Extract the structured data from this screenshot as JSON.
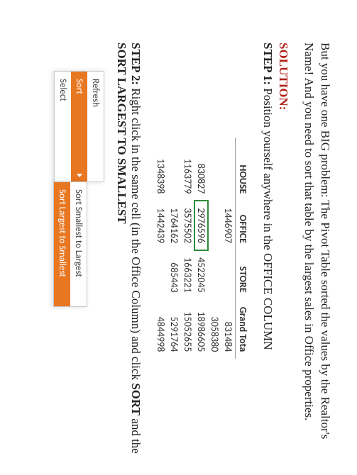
{
  "intro": "But you have one BIG problem: The Pivot Table sorted the values by the Realtor's Name! And you need to sort that table by the largest sales in Office properties.",
  "solution_label": "SOLUTION:",
  "step1_label": "STEP 1:",
  "step1_text": " Position yourself anywhere in the OFFICE COLUMN",
  "step2_label": "STEP 2:",
  "step2_text_a": " Right click in the same cell (in the Office Column) and click ",
  "step2_sort": "SORT",
  "step2_text_b": " and the ",
  "step2_opt": "SORT LARGEST TO SMALLEST",
  "headers": {
    "c0": "",
    "c1": "HOUSE",
    "c2": "OFFICE",
    "c3": "STORE",
    "c4": "Grand Tota"
  },
  "rows": [
    {
      "c0": "",
      "c1": "",
      "c2": "1446907",
      "c3": "",
      "c4": "831484"
    },
    {
      "c0": "",
      "c1": "",
      "c2": "",
      "c3": "",
      "c4": "3058380"
    },
    {
      "c0": "",
      "c1": "830827",
      "c2": "2976596",
      "c3": "4522045",
      "c4": "18986605"
    },
    {
      "c0": "",
      "c1": "1163779",
      "c2": "3575502",
      "c3": "1663221",
      "c4": "15052655"
    },
    {
      "c0": "",
      "c1": "",
      "c2": "1764162",
      "c3": "685443",
      "c4": "5291764"
    },
    {
      "c0": "",
      "c1": "1348398",
      "c2": "1442439",
      "c3": "",
      "c4": "4844998"
    }
  ],
  "menu": {
    "refresh": "Refresh",
    "sort": "Sort",
    "select": "Select"
  },
  "submenu": {
    "s2l": "Sort Smallest to Largest",
    "l2s": "Sort Largest to Smallest"
  }
}
